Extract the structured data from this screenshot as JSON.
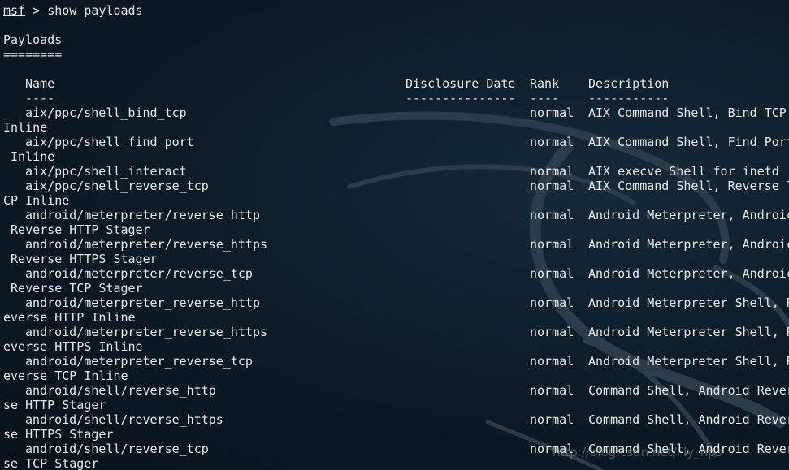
{
  "prompt": {
    "name": "msf",
    "separator": " > ",
    "command": "show payloads"
  },
  "section": {
    "title": "Payloads",
    "underline": "========"
  },
  "headers": {
    "name": "Name",
    "date": "Disclosure Date",
    "rank": "Rank",
    "desc": "Description"
  },
  "header_rules": {
    "name": "----",
    "date": "---------------",
    "rank": "----",
    "desc": "-----------"
  },
  "rows": [
    {
      "name": "aix/ppc/shell_bind_tcp",
      "rank": "normal",
      "desc": "AIX Command Shell, Bind TCP",
      "wrap": "Inline"
    },
    {
      "name": "aix/ppc/shell_find_port",
      "rank": "normal",
      "desc": "AIX Command Shell, Find Port",
      "wrap": " Inline"
    },
    {
      "name": "aix/ppc/shell_interact",
      "rank": "normal",
      "desc": "AIX execve Shell for inetd",
      "wrap": null
    },
    {
      "name": "aix/ppc/shell_reverse_tcp",
      "rank": "normal",
      "desc": "AIX Command Shell, Reverse T",
      "wrap": "CP Inline"
    },
    {
      "name": "android/meterpreter/reverse_http",
      "rank": "normal",
      "desc": "Android Meterpreter, Androic",
      "wrap": " Reverse HTTP Stager"
    },
    {
      "name": "android/meterpreter/reverse_https",
      "rank": "normal",
      "desc": "Android Meterpreter, Androic",
      "wrap": " Reverse HTTPS Stager"
    },
    {
      "name": "android/meterpreter/reverse_tcp",
      "rank": "normal",
      "desc": "Android Meterpreter, Androic",
      "wrap": " Reverse TCP Stager"
    },
    {
      "name": "android/meterpreter_reverse_http",
      "rank": "normal",
      "desc": "Android Meterpreter Shell, R",
      "wrap": "everse HTTP Inline"
    },
    {
      "name": "android/meterpreter_reverse_https",
      "rank": "normal",
      "desc": "Android Meterpreter Shell, R",
      "wrap": "everse HTTPS Inline"
    },
    {
      "name": "android/meterpreter_reverse_tcp",
      "rank": "normal",
      "desc": "Android Meterpreter Shell, R",
      "wrap": "everse TCP Inline"
    },
    {
      "name": "android/shell/reverse_http",
      "rank": "normal",
      "desc": "Command Shell, Android Rever",
      "wrap": "se HTTP Stager"
    },
    {
      "name": "android/shell/reverse_https",
      "rank": "normal",
      "desc": "Command Shell, Android Rever",
      "wrap": "se HTTPS Stager"
    },
    {
      "name": "android/shell/reverse_tcp",
      "rank": "normal",
      "desc": "Command Shell, Android Rever",
      "wrap": "se TCP Stager"
    }
  ],
  "watermark": "http://blog.csdn.net/Fly_hps",
  "colors": {
    "background": "#0d1c28",
    "text": "#e8e8e8",
    "dragon": "#2a3a48"
  }
}
